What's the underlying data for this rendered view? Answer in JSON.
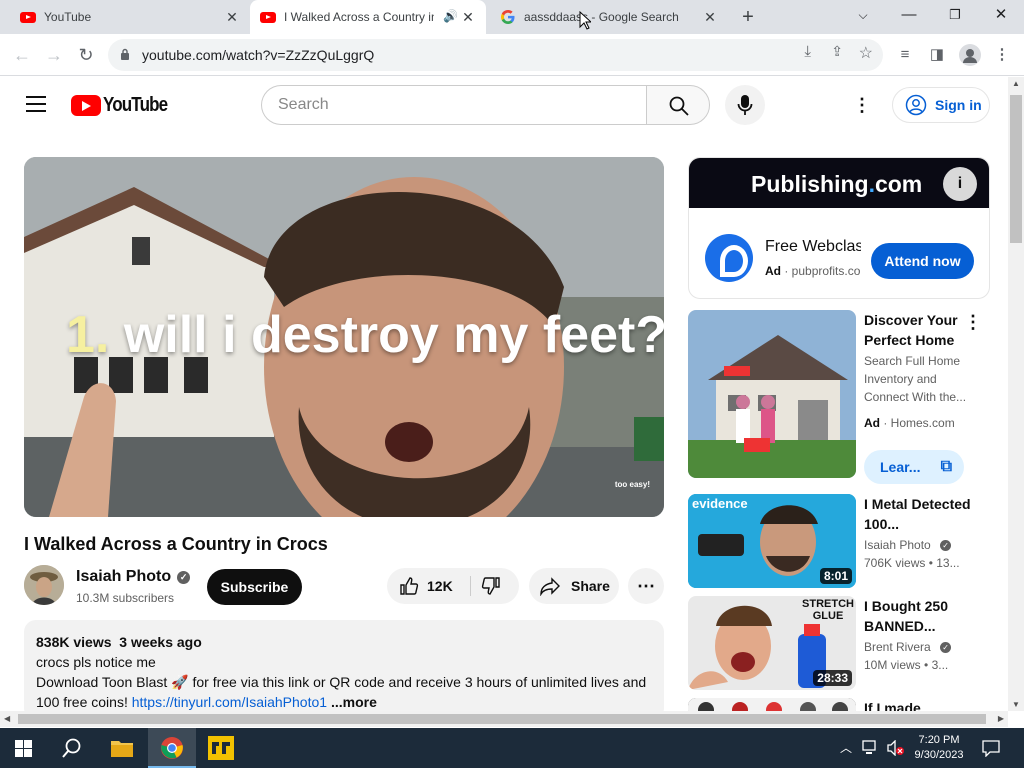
{
  "browser": {
    "tabs": [
      {
        "title": "YouTube",
        "favicon": "youtube-favicon"
      },
      {
        "title": "I Walked Across a Country in Crocs - YouTube",
        "favicon": "youtube-favicon",
        "active": true
      },
      {
        "title": "aassddaass - Google Search",
        "favicon": "google-favicon"
      }
    ],
    "new_tab_label": "+",
    "url": "youtube.com/watch?v=ZzZzQuLggrQ"
  },
  "youtube": {
    "search_placeholder": "Search",
    "sign_in_label": "Sign in",
    "video": {
      "overlay_number": "1.",
      "overlay_text": "will i destroy my feet?",
      "watermark": "too easy!",
      "title": "I Walked Across a Country in Crocs"
    },
    "channel": {
      "name": "Isaiah Photo",
      "subscribers": "10.3M subscribers",
      "subscribe_label": "Subscribe"
    },
    "actions": {
      "likes": "12K",
      "share_label": "Share"
    },
    "description": {
      "views": "838K views",
      "age": "3 weeks ago",
      "line1": "crocs pls notice me",
      "line2": "Download Toon Blast 🚀 for free via this link or QR code and receive 3 hours of unlimited lives and",
      "line3_prefix": "100 free coins!",
      "link": "https://tinyurl.com/IsaiahPhoto1",
      "more": "...more"
    },
    "ad": {
      "brand_first": "P",
      "brand_mid": "ublishing",
      "brand_dot": ".",
      "brand_end": "com",
      "name": "Free Webclass: Kindle Publishing",
      "badge": "Ad",
      "domain": "pubprofits.com",
      "cta": "Attend now"
    },
    "recommendations": [
      {
        "title": "Discover Your Perfect Home",
        "line1": "Search Full Home",
        "line2": "Inventory and",
        "line3": "Connect With the...",
        "badge": "Ad",
        "domain": "Homes.com",
        "cta": "Lear..."
      },
      {
        "title": "I Metal Detected 100...",
        "channel": "Isaiah Photo",
        "views": "706K views",
        "age": "13...",
        "duration": "8:01",
        "thumb_text": "evidence"
      },
      {
        "title": "I Bought 250 BANNED...",
        "channel": "Brent Rivera",
        "views": "10M views",
        "age": "3...",
        "duration": "28:33",
        "thumb_text": "STRETCH GLUE"
      },
      {
        "title": "If I made"
      }
    ]
  },
  "taskbar": {
    "time": "7:20 PM",
    "date": "9/30/2023"
  },
  "colors": {
    "youtube_red": "#ff0000",
    "link_blue": "#065fd4",
    "subscribe_black": "#0f0f0f",
    "tab_strip": "#dee1e6",
    "taskbar": "#1c2b3a"
  }
}
